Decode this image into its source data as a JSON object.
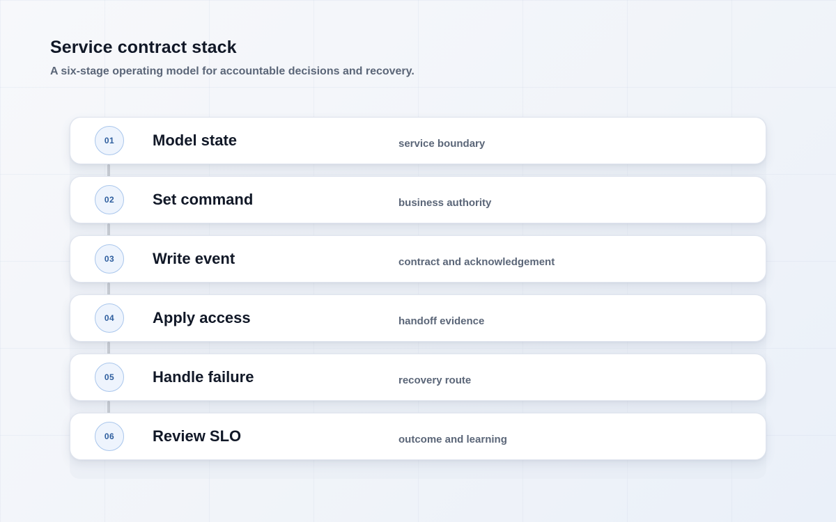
{
  "header": {
    "title": "Service contract stack",
    "subtitle": "A six-stage operating model for accountable decisions and recovery."
  },
  "stages": [
    {
      "number": "01",
      "title": "Model state",
      "note": "service boundary"
    },
    {
      "number": "02",
      "title": "Set command",
      "note": "business authority"
    },
    {
      "number": "03",
      "title": "Write event",
      "note": "contract and acknowledgement"
    },
    {
      "number": "04",
      "title": "Apply access",
      "note": "handoff evidence"
    },
    {
      "number": "05",
      "title": "Handle failure",
      "note": "recovery route"
    },
    {
      "number": "06",
      "title": "Review SLO",
      "note": "outcome and learning"
    }
  ],
  "colors": {
    "badge_border": "#a9c6ec",
    "badge_text": "#2e5e9e",
    "connector": "#c8ccd3"
  }
}
